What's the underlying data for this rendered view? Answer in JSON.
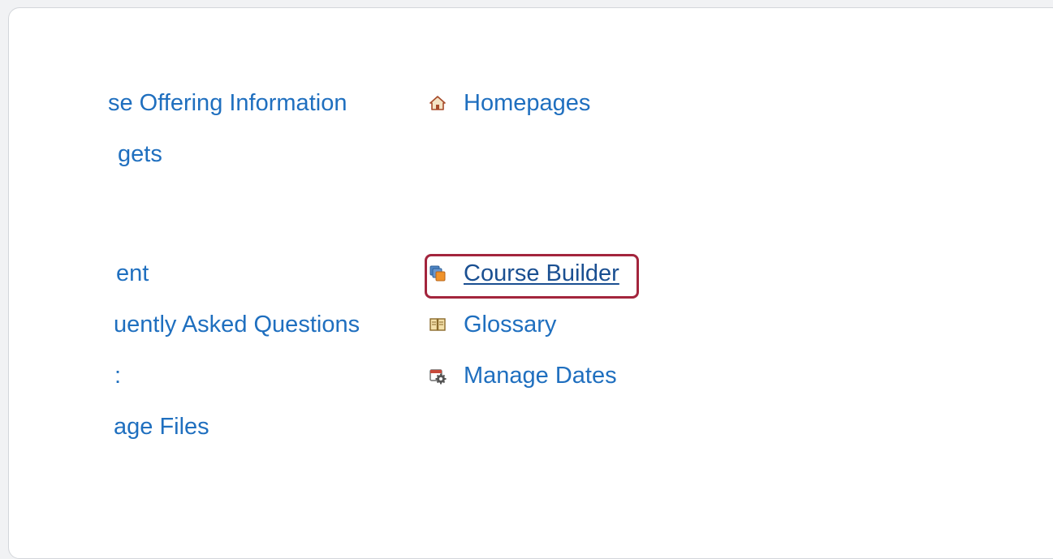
{
  "left_column": {
    "items": [
      {
        "label": "se Offering Information"
      },
      {
        "label": "gets"
      },
      {
        "label": "ent"
      },
      {
        "label": "uently Asked Questions"
      },
      {
        "label": ":"
      },
      {
        "label": "age Files"
      }
    ]
  },
  "right_column": {
    "items": [
      {
        "label": "Homepages",
        "icon": "house-icon"
      },
      {
        "label": "Course Builder",
        "icon": "course-builder-icon"
      },
      {
        "label": "Glossary",
        "icon": "book-icon"
      },
      {
        "label": "Manage Dates",
        "icon": "calendar-gear-icon"
      }
    ]
  },
  "colors": {
    "link": "#1f6fbf",
    "highlight_border": "#a3253d"
  }
}
